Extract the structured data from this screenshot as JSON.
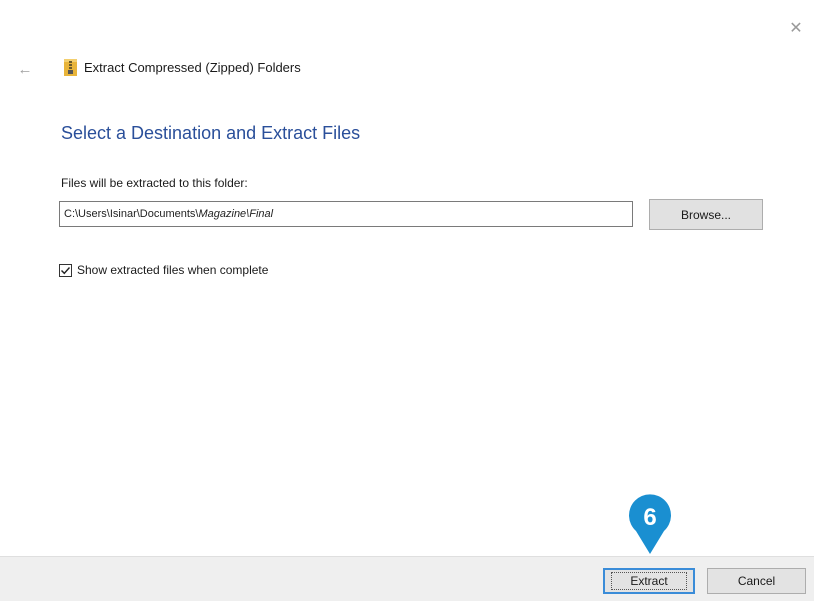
{
  "window": {
    "title": "Extract Compressed (Zipped) Folders",
    "close_glyph": "✕",
    "back_glyph": "←"
  },
  "main": {
    "heading": "Select a Destination and Extract Files",
    "destination_label": "Files will be extracted to this folder:",
    "destination_path_prefix": "C:\\Users\\Isinar\\Documents\\",
    "destination_path_italic": "Magazine\\Final",
    "browse_label": "Browse...",
    "show_files_label": "Show extracted files when complete",
    "show_files_checked": true
  },
  "footer": {
    "extract_label": "Extract",
    "cancel_label": "Cancel"
  },
  "annotation": {
    "step_number": "6",
    "color": "#1a8fd1"
  },
  "colors": {
    "heading": "#2a4f9a",
    "footer_bg": "#efefef",
    "focus_border": "#3a8cd8"
  }
}
